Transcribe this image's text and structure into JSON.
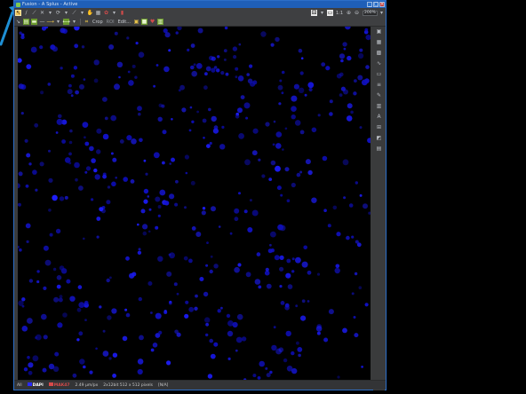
{
  "window": {
    "title": "Fusion - A Splus - Active",
    "buttons": {
      "minimize": "_",
      "maximize": "□",
      "close": "×"
    }
  },
  "toolbar_top": {
    "zoom_value": "200%",
    "one_to_one": "1:1"
  },
  "toolbar_second": {
    "crop_label": "Crop",
    "roi_label": "ROI",
    "edit_label": "Edit..."
  },
  "right_tools": [
    "square-select-icon",
    "grid-icon",
    "grid-dense-icon",
    "curve-icon",
    "panel-icon",
    "layers-icon",
    "pen-icon",
    "stack-icon",
    "text-icon",
    "ruler-icon",
    "palette-icon",
    "chart-icon"
  ],
  "status": {
    "all": "All",
    "channel1": "DAPI",
    "channel2": "MAK47",
    "scale": "2.49 µm/px",
    "dims": "2x12bit 512 x 512 pixels",
    "value": "[N/A]"
  },
  "colors": {
    "titlebar": "#1f5fb8",
    "accent_arrow": "#1e8fd4",
    "nucleus": "#1a1aff",
    "chrome": "#3a3b3c"
  }
}
